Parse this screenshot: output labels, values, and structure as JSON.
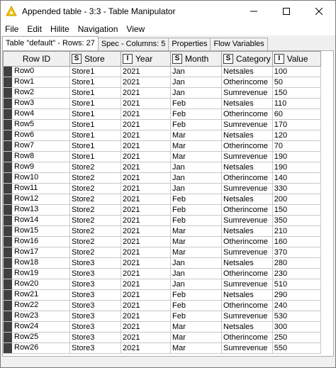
{
  "window": {
    "title": "Appended table - 3:3 - Table Manipulator"
  },
  "menu": [
    "File",
    "Edit",
    "Hilite",
    "Navigation",
    "View"
  ],
  "tabs": [
    {
      "label": "Table \"default\" - Rows: 27",
      "active": true
    },
    {
      "label": "Spec - Columns: 5",
      "active": false
    },
    {
      "label": "Properties",
      "active": false
    },
    {
      "label": "Flow Variables",
      "active": false
    }
  ],
  "columns": [
    {
      "type": "",
      "label": "Row ID"
    },
    {
      "type": "S",
      "label": "Store"
    },
    {
      "type": "I",
      "label": "Year"
    },
    {
      "type": "S",
      "label": "Month"
    },
    {
      "type": "S",
      "label": "Category"
    },
    {
      "type": "I",
      "label": "Value"
    }
  ],
  "rows": [
    [
      "Row0",
      "Store1",
      "2021",
      "Jan",
      "Netsales",
      "100"
    ],
    [
      "Row1",
      "Store1",
      "2021",
      "Jan",
      "Otherincome",
      "50"
    ],
    [
      "Row2",
      "Store1",
      "2021",
      "Jan",
      "Sumrevenue",
      "150"
    ],
    [
      "Row3",
      "Store1",
      "2021",
      "Feb",
      "Netsales",
      "110"
    ],
    [
      "Row4",
      "Store1",
      "2021",
      "Feb",
      "Otherincome",
      "60"
    ],
    [
      "Row5",
      "Store1",
      "2021",
      "Feb",
      "Sumrevenue",
      "170"
    ],
    [
      "Row6",
      "Store1",
      "2021",
      "Mar",
      "Netsales",
      "120"
    ],
    [
      "Row7",
      "Store1",
      "2021",
      "Mar",
      "Otherincome",
      "70"
    ],
    [
      "Row8",
      "Store1",
      "2021",
      "Mar",
      "Sumrevenue",
      "190"
    ],
    [
      "Row9",
      "Store2",
      "2021",
      "Jan",
      "Netsales",
      "190"
    ],
    [
      "Row10",
      "Store2",
      "2021",
      "Jan",
      "Otherincome",
      "140"
    ],
    [
      "Row11",
      "Store2",
      "2021",
      "Jan",
      "Sumrevenue",
      "330"
    ],
    [
      "Row12",
      "Store2",
      "2021",
      "Feb",
      "Netsales",
      "200"
    ],
    [
      "Row13",
      "Store2",
      "2021",
      "Feb",
      "Otherincome",
      "150"
    ],
    [
      "Row14",
      "Store2",
      "2021",
      "Feb",
      "Sumrevenue",
      "350"
    ],
    [
      "Row15",
      "Store2",
      "2021",
      "Mar",
      "Netsales",
      "210"
    ],
    [
      "Row16",
      "Store2",
      "2021",
      "Mar",
      "Otherincome",
      "160"
    ],
    [
      "Row17",
      "Store2",
      "2021",
      "Mar",
      "Sumrevenue",
      "370"
    ],
    [
      "Row18",
      "Store3",
      "2021",
      "Jan",
      "Netsales",
      "280"
    ],
    [
      "Row19",
      "Store3",
      "2021",
      "Jan",
      "Otherincome",
      "230"
    ],
    [
      "Row20",
      "Store3",
      "2021",
      "Jan",
      "Sumrevenue",
      "510"
    ],
    [
      "Row21",
      "Store3",
      "2021",
      "Feb",
      "Netsales",
      "290"
    ],
    [
      "Row22",
      "Store3",
      "2021",
      "Feb",
      "Otherincome",
      "240"
    ],
    [
      "Row23",
      "Store3",
      "2021",
      "Feb",
      "Sumrevenue",
      "530"
    ],
    [
      "Row24",
      "Store3",
      "2021",
      "Mar",
      "Netsales",
      "300"
    ],
    [
      "Row25",
      "Store3",
      "2021",
      "Mar",
      "Otherincome",
      "250"
    ],
    [
      "Row26",
      "Store3",
      "2021",
      "Mar",
      "Sumrevenue",
      "550"
    ]
  ],
  "colors": {
    "rowid_marker": "#404040",
    "header_bg": "#f0f0f0",
    "grid": "#c8c8c8"
  }
}
